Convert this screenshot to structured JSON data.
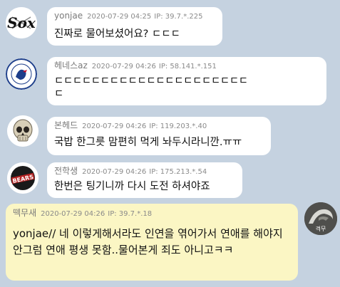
{
  "messages": [
    {
      "nick": "yonjae",
      "date": "2020-07-29 04:25",
      "ip": "IP: 39.7.*.225",
      "text": "진짜로 물어보셨어요? ㄷㄷㄷ"
    },
    {
      "nick": "헤네스az",
      "date": "2020-07-29 04:26",
      "ip": "IP: 58.141.*.151",
      "text_line1": "ㄷㄷㄷㄷㄷㄷㄷㄷㄷㄷㄷㄷㄷㄷㄷㄷㄷㄷㄷㄷㄷ",
      "text_line2": "ㄷ"
    },
    {
      "nick": "본헤드",
      "date": "2020-07-29 04:26",
      "ip": "IP: 119.203.*.40",
      "text": "국밥 한그릇 맘편히 먹게 놔두시라니깐.ㅠㅠ"
    },
    {
      "nick": "전학생",
      "date": "2020-07-29 04:26",
      "ip": "IP: 175.213.*.54",
      "text": "한번은 팅기니까 다시 도전 하셔야죠"
    },
    {
      "nick": "떽무새",
      "date": "2020-07-29 04:26",
      "ip": "IP: 39.7.*.18",
      "text": "yonjae// 네 이렇게해서라도 인연을 엮어가서 연애를 해야지 안그럼 연애 평생 못함..물어본게 죄도 아니고ㅋㅋ",
      "avatar_text": "격무"
    }
  ],
  "colors": {
    "background": "#c5d2e0",
    "bubble_other": "#ffffff",
    "bubble_mine": "#fbf6c4"
  },
  "icons": [
    "white-sox-logo-icon",
    "copenhagen-lion-logo-icon",
    "skull-icon",
    "bears-logo-icon",
    "photo-avatar-icon"
  ]
}
